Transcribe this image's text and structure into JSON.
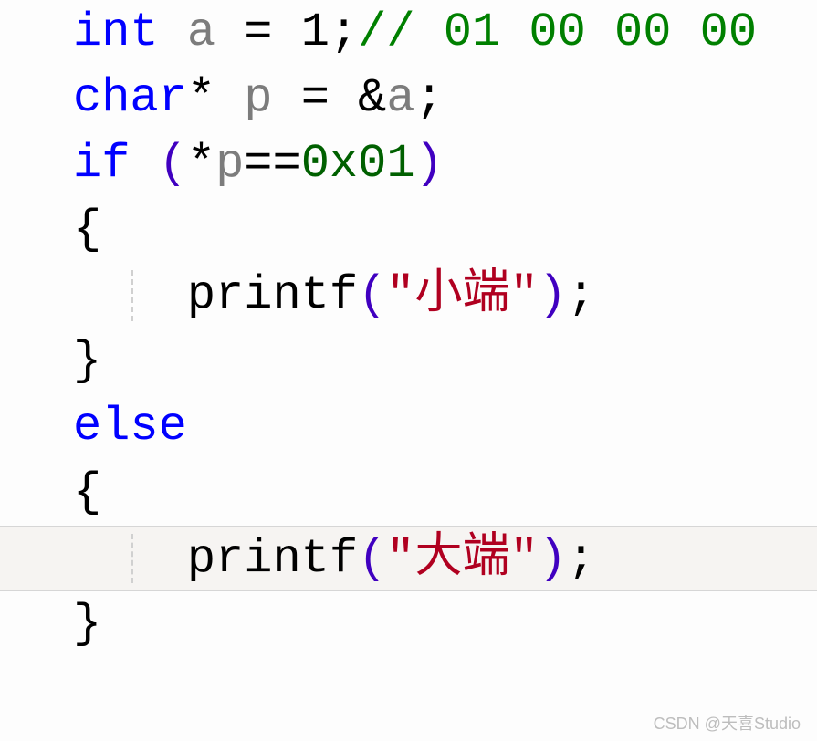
{
  "code": {
    "line1": {
      "kw": "int",
      "sp1": " ",
      "id": "a",
      "sp2": " ",
      "op": "=",
      "sp3": " ",
      "num": "1",
      "semi": ";",
      "cmt": "// 01 00 00 00"
    },
    "line2": {
      "kw": "char",
      "star": "*",
      "sp1": " ",
      "id": "p",
      "sp2": " ",
      "op": "=",
      "sp3": " ",
      "amp": "&",
      "id2": "a",
      "semi": ";"
    },
    "line3": {
      "kw": "if",
      "sp1": " ",
      "lp": "(",
      "star": "*",
      "id": "p",
      "eq": "==",
      "hex": "0x01",
      "rp": ")"
    },
    "line4": {
      "brace": "{"
    },
    "line5": {
      "indent": "    ",
      "fn": "printf",
      "lp": "(",
      "str": "\"小端\"",
      "rp": ")",
      "semi": ";"
    },
    "line6": {
      "brace": "}"
    },
    "line7": {
      "kw": "else"
    },
    "line8": {
      "brace": "{"
    },
    "line9": {
      "indent": "    ",
      "fn": "printf",
      "lp": "(",
      "str": "\"大端\"",
      "rp": ")",
      "semi": ";"
    },
    "line10": {
      "brace": "}"
    }
  },
  "watermark": "CSDN @天喜Studio"
}
